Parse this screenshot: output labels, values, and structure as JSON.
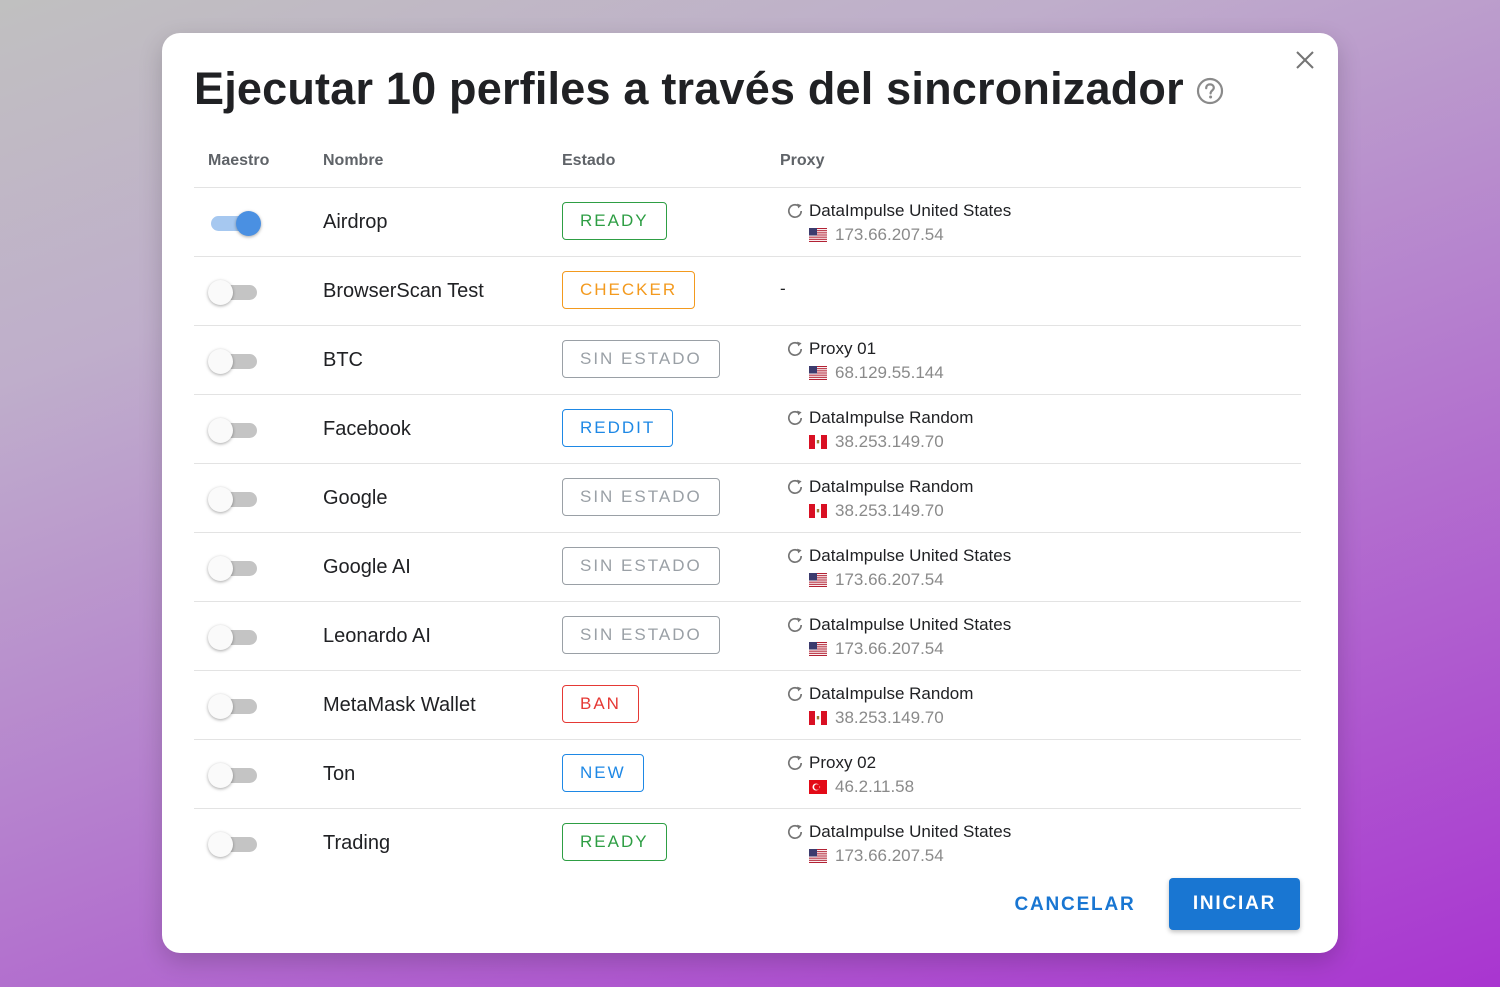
{
  "dialog": {
    "title": "Ejecutar 10 perfiles a través del sincronizador",
    "help_icon": "help-circle-icon",
    "close_icon": "close-icon"
  },
  "columns": {
    "master": "Maestro",
    "name": "Nombre",
    "status": "Estado",
    "proxy": "Proxy"
  },
  "status_colors": {
    "ready": "#2e9e44",
    "checker": "#f39a1e",
    "none": "#9aa0a6",
    "reddit": "#1e88e5",
    "ban": "#e53935",
    "new": "#1e88e5"
  },
  "profiles": [
    {
      "master": true,
      "name": "Airdrop",
      "status": "READY",
      "status_color": "#2e9e44",
      "proxy_name": "DataImpulse United States",
      "proxy_ip": "173.66.207.54",
      "flag": "us"
    },
    {
      "master": false,
      "name": "BrowserScan Test",
      "status": "CHECKER",
      "status_color": "#f39a1e",
      "proxy_name": "",
      "proxy_ip": "",
      "flag": "",
      "proxy_empty": "-"
    },
    {
      "master": false,
      "name": "BTC",
      "status": "SIN ESTADO",
      "status_color": "#9aa0a6",
      "proxy_name": "Proxy 01",
      "proxy_ip": "68.129.55.144",
      "flag": "us"
    },
    {
      "master": false,
      "name": "Facebook",
      "status": "REDDIT",
      "status_color": "#1e88e5",
      "proxy_name": "DataImpulse Random",
      "proxy_ip": "38.253.149.70",
      "flag": "pe"
    },
    {
      "master": false,
      "name": "Google",
      "status": "SIN ESTADO",
      "status_color": "#9aa0a6",
      "proxy_name": "DataImpulse Random",
      "proxy_ip": "38.253.149.70",
      "flag": "pe"
    },
    {
      "master": false,
      "name": "Google AI",
      "status": "SIN ESTADO",
      "status_color": "#9aa0a6",
      "proxy_name": "DataImpulse United States",
      "proxy_ip": "173.66.207.54",
      "flag": "us"
    },
    {
      "master": false,
      "name": "Leonardo AI",
      "status": "SIN ESTADO",
      "status_color": "#9aa0a6",
      "proxy_name": "DataImpulse United States",
      "proxy_ip": "173.66.207.54",
      "flag": "us"
    },
    {
      "master": false,
      "name": "MetaMask Wallet",
      "status": "BAN",
      "status_color": "#e53935",
      "proxy_name": "DataImpulse Random",
      "proxy_ip": "38.253.149.70",
      "flag": "pe"
    },
    {
      "master": false,
      "name": "Ton",
      "status": "NEW",
      "status_color": "#1e88e5",
      "proxy_name": "Proxy 02",
      "proxy_ip": "46.2.11.58",
      "flag": "tr"
    },
    {
      "master": false,
      "name": "Trading",
      "status": "READY",
      "status_color": "#2e9e44",
      "proxy_name": "DataImpulse United States",
      "proxy_ip": "173.66.207.54",
      "flag": "us"
    }
  ],
  "actions": {
    "cancel_label": "CANCELAR",
    "start_label": "INICIAR",
    "primary_color": "#1976d2"
  }
}
